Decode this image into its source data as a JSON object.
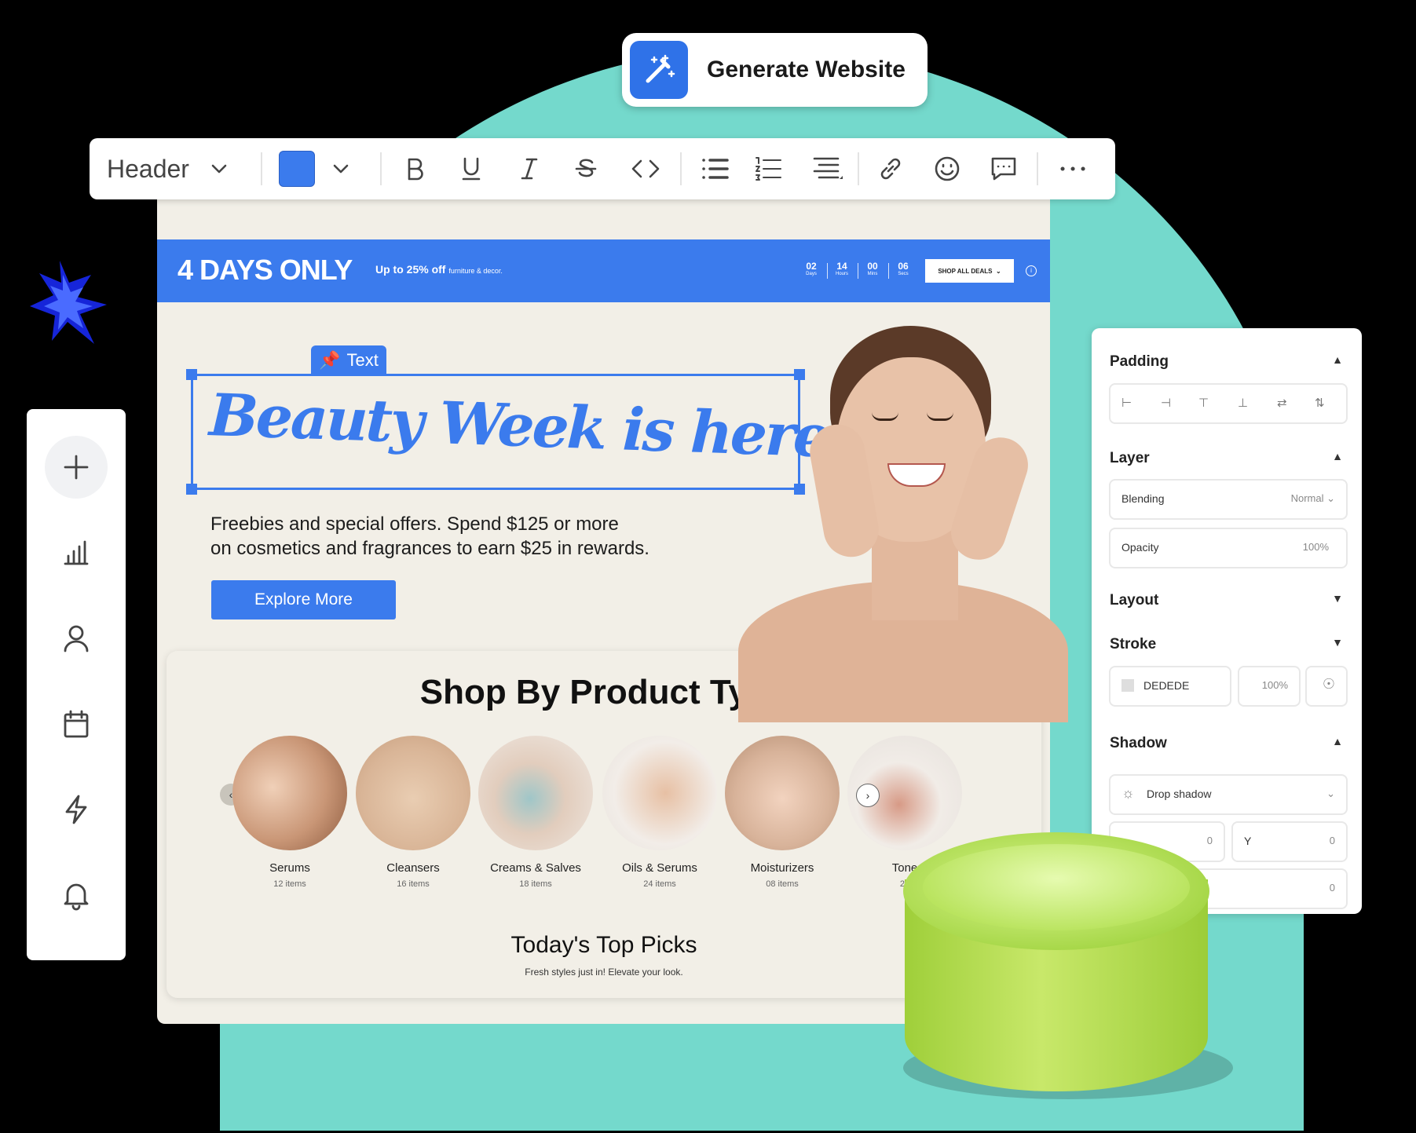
{
  "generate_button": {
    "label": "Generate Website"
  },
  "toolbar": {
    "style_value": "Header",
    "color_swatch": "#3b7bed",
    "icons": [
      "chevron-down-icon",
      "bold-icon",
      "underline-icon",
      "italic-icon",
      "strikethrough-icon",
      "code-icon",
      "bullet-list-icon",
      "numbered-list-icon",
      "align-icon",
      "link-icon",
      "emoji-icon",
      "comment-icon",
      "more-icon"
    ]
  },
  "promo": {
    "title": "4 DAYS ONLY",
    "subtitle": "Up to 25% off",
    "subtitle_small": "furniture & decor.",
    "countdown": [
      {
        "value": "02",
        "unit": "Days"
      },
      {
        "value": "14",
        "unit": "Hours"
      },
      {
        "value": "00",
        "unit": "Mins"
      },
      {
        "value": "06",
        "unit": "Secs"
      }
    ],
    "cta": "SHOP ALL DEALS",
    "info": "i"
  },
  "hero": {
    "tag": "Text",
    "headline": "Beauty Week is here",
    "description_line1": "Freebies and special offers. Spend $125 or more",
    "description_line2": "on cosmetics and fragrances to earn $25 in rewards.",
    "button": "Explore More"
  },
  "shop": {
    "title": "Shop By Product Type",
    "products": [
      {
        "name": "Serums",
        "count": "12 items"
      },
      {
        "name": "Cleansers",
        "count": "16 items"
      },
      {
        "name": "Creams & Salves",
        "count": "18 items"
      },
      {
        "name": "Oils & Serums",
        "count": "24 items"
      },
      {
        "name": "Moisturizers",
        "count": "08 items"
      },
      {
        "name": "Tone",
        "count": "26"
      }
    ],
    "picks_title": "Today's Top Picks",
    "picks_sub": "Fresh styles just in! Elevate your look."
  },
  "sidebar": {
    "items": [
      "add-icon",
      "analytics-icon",
      "user-icon",
      "calendar-icon",
      "lightning-icon",
      "bell-icon"
    ]
  },
  "props": {
    "padding": {
      "label": "Padding"
    },
    "layer": {
      "label": "Layer",
      "blending_label": "Blending",
      "blending_value": "Normal",
      "opacity_label": "Opacity",
      "opacity_value": "100%"
    },
    "layout": {
      "label": "Layout"
    },
    "stroke": {
      "label": "Stroke",
      "color": "DEDEDE",
      "opacity": "100%"
    },
    "shadow": {
      "label": "Shadow",
      "type": "Drop shadow",
      "y_label": "Y",
      "x_value": "0",
      "y_value": "0",
      "blur_value": "0"
    }
  },
  "colors": {
    "accent": "#3b7bed",
    "teal": "#74d9cc",
    "canvas": "#f2efe7"
  }
}
